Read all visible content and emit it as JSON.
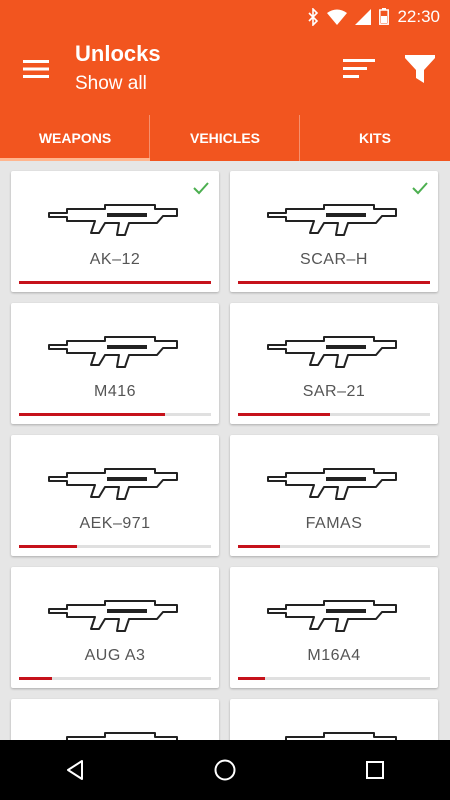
{
  "status_bar": {
    "time": "22:30",
    "icons": [
      "bluetooth-icon",
      "wifi-icon",
      "signal-icon",
      "battery-icon"
    ]
  },
  "app_bar": {
    "title": "Unlocks",
    "subtitle": "Show all",
    "icons": [
      "menu-icon",
      "sort-icon",
      "filter-icon"
    ]
  },
  "tabs": [
    {
      "label": "WEAPONS",
      "selected": true
    },
    {
      "label": "VEHICLES",
      "selected": false
    },
    {
      "label": "KITS",
      "selected": false
    }
  ],
  "weapons": [
    {
      "name": "AK–12",
      "progress": 1.0,
      "unlocked": true
    },
    {
      "name": "SCAR–H",
      "progress": 1.0,
      "unlocked": true
    },
    {
      "name": "M416",
      "progress": 0.76,
      "unlocked": false
    },
    {
      "name": "SAR–21",
      "progress": 0.48,
      "unlocked": false
    },
    {
      "name": "AEK–971",
      "progress": 0.3,
      "unlocked": false
    },
    {
      "name": "FAMAS",
      "progress": 0.22,
      "unlocked": false
    },
    {
      "name": "AUG A3",
      "progress": 0.17,
      "unlocked": false
    },
    {
      "name": "M16A4",
      "progress": 0.14,
      "unlocked": false
    },
    {
      "name": "",
      "progress": 0,
      "unlocked": false
    },
    {
      "name": "",
      "progress": 0,
      "unlocked": false
    }
  ],
  "colors": {
    "primary": "#f2551f",
    "progress": "#c6121b",
    "check": "#4caf50",
    "indicator": "#ffb58e"
  },
  "nav_bar": {
    "icons": [
      "back-icon",
      "home-icon",
      "recents-icon"
    ]
  }
}
